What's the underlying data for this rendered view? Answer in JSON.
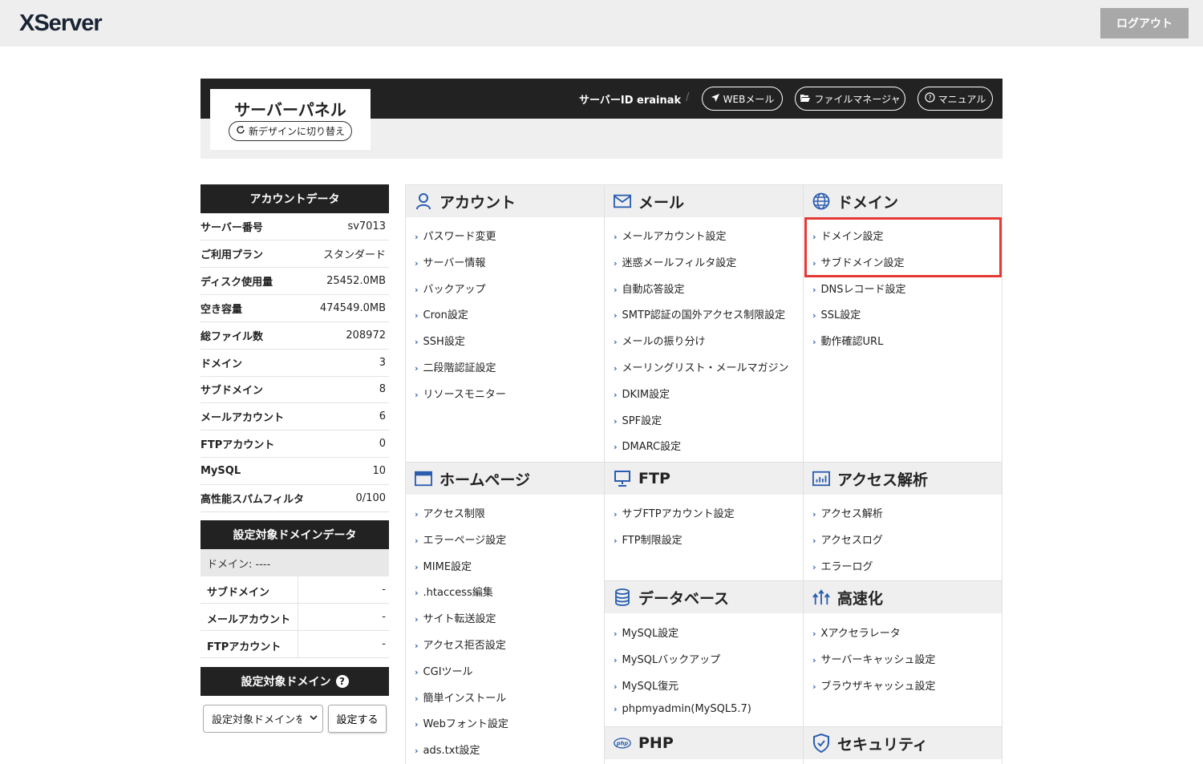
{
  "header": {
    "logo": "XServer",
    "logout": "ログアウト"
  },
  "panel": {
    "title": "サーバーパネル",
    "switch_design": "新デザインに切り替え",
    "server_id": "サーバーID erainak",
    "separator": "/",
    "web_mail": "WEBメール",
    "file_manager": "ファイルマネージャ",
    "manual": "マニュアル"
  },
  "account_data": {
    "title": "アカウントデータ",
    "rows": [
      {
        "key": "サーバー番号",
        "value": "sv7013"
      },
      {
        "key": "ご利用プラン",
        "value": "スタンダード"
      },
      {
        "key": "ディスク使用量",
        "value": "25452.0MB"
      },
      {
        "key": "空き容量",
        "value": "474549.0MB"
      },
      {
        "key": "総ファイル数",
        "value": "208972"
      },
      {
        "key": "ドメイン",
        "value": "3"
      },
      {
        "key": "サブドメイン",
        "value": "8"
      },
      {
        "key": "メールアカウント",
        "value": "6"
      },
      {
        "key": "FTPアカウント",
        "value": "0"
      },
      {
        "key": "MySQL",
        "value": "10"
      },
      {
        "key": "高性能スパムフィルタ",
        "value": "0/100"
      }
    ]
  },
  "domain_data": {
    "title": "設定対象ドメインデータ",
    "domain_line": "ドメイン: ----",
    "rows": [
      {
        "key": "サブドメイン",
        "value": "-"
      },
      {
        "key": "メールアカウント",
        "value": "-"
      },
      {
        "key": "FTPアカウント",
        "value": "-"
      }
    ]
  },
  "target_domain": {
    "title": "設定対象ドメイン",
    "help": "?",
    "select_value": "設定対象ドメインを選択",
    "apply": "設定する"
  },
  "sections": {
    "account": {
      "title": "アカウント",
      "icon": "user-icon",
      "items": [
        "パスワード変更",
        "サーバー情報",
        "バックアップ",
        "Cron設定",
        "SSH設定",
        "二段階認証設定",
        "リソースモニター"
      ]
    },
    "mail": {
      "title": "メール",
      "icon": "envelope-icon",
      "items": [
        "メールアカウント設定",
        "迷惑メールフィルタ設定",
        "自動応答設定",
        "SMTP認証の国外アクセス制限設定",
        "メールの振り分け",
        "メーリングリスト・メールマガジン",
        "DKIM設定",
        "SPF設定",
        "DMARC設定"
      ]
    },
    "domain": {
      "title": "ドメイン",
      "icon": "globe-icon",
      "items": [
        "ドメイン設定",
        "サブドメイン設定",
        "DNSレコード設定",
        "SSL設定",
        "動作確認URL"
      ]
    },
    "homepage": {
      "title": "ホームページ",
      "icon": "browser-icon",
      "items": [
        "アクセス制限",
        "エラーページ設定",
        "MIME設定",
        ".htaccess編集",
        "サイト転送設定",
        "アクセス拒否設定",
        "CGIツール",
        "簡単インストール",
        "Webフォント設定",
        "ads.txt設定"
      ]
    },
    "ftp": {
      "title": "FTP",
      "icon": "monitor-icon",
      "items": [
        "サブFTPアカウント設定",
        "FTP制限設定"
      ]
    },
    "analytics": {
      "title": "アクセス解析",
      "icon": "bar-chart-icon",
      "items": [
        "アクセス解析",
        "アクセスログ",
        "エラーログ"
      ]
    },
    "database": {
      "title": "データベース",
      "icon": "database-icon",
      "items": [
        "MySQL設定",
        "MySQLバックアップ",
        "MySQL復元",
        "phpmyadmin(MySQL5.7)"
      ]
    },
    "speed": {
      "title": "高速化",
      "icon": "speed-arrows-icon",
      "items": [
        "Xアクセラレータ",
        "サーバーキャッシュ設定",
        "ブラウザキャッシュ設定"
      ]
    },
    "php": {
      "title": "PHP",
      "icon": "php-icon",
      "badge": "php"
    },
    "security": {
      "title": "セキュリティ",
      "icon": "shield-icon"
    }
  },
  "colors": {
    "accent": "#2a5db0",
    "dark": "#222222",
    "highlight": "#e53935"
  }
}
